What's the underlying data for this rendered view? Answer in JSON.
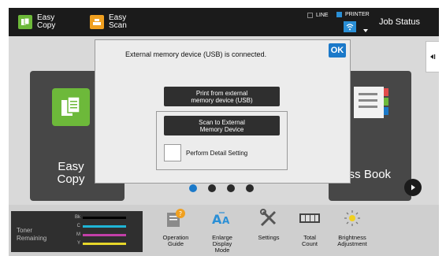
{
  "topbar": {
    "easy_copy": "Easy\nCopy",
    "easy_scan": "Easy\nScan",
    "line": "LINE",
    "printer": "PRINTER",
    "job_status": "Job Status"
  },
  "home": {
    "easy_copy_title": "Easy\nCopy",
    "address_book_title": "dress Book",
    "page_count": 4,
    "active_page": 1
  },
  "dialog": {
    "message": "External memory device (USB) is connected.",
    "ok": "OK",
    "print_button": "Print from external\nmemory device (USB)",
    "scan_button": "Scan to External\nMemory Device",
    "detail_setting": "Perform Detail Setting"
  },
  "bottom": {
    "toner_title": "Toner\nRemaining",
    "toner": [
      {
        "label": "Bk",
        "color": "#000000"
      },
      {
        "label": "C",
        "color": "#1fb5d6"
      },
      {
        "label": "M",
        "color": "#c23fa8"
      },
      {
        "label": "Y",
        "color": "#e6d62a"
      }
    ],
    "shortcuts": [
      {
        "label": "Operation\nGuide",
        "icon": "operation-guide-icon"
      },
      {
        "label": "Enlarge\nDisplay\nMode",
        "icon": "enlarge-display-icon"
      },
      {
        "label": "Settings",
        "icon": "settings-icon"
      },
      {
        "label": "Total\nCount",
        "icon": "total-count-icon"
      },
      {
        "label": "Brightness\nAdjustment",
        "icon": "brightness-icon"
      }
    ]
  },
  "colors": {
    "accent_blue": "#1b79c9",
    "easy_copy_green": "#6db93a",
    "easy_scan_orange": "#f0a020"
  }
}
